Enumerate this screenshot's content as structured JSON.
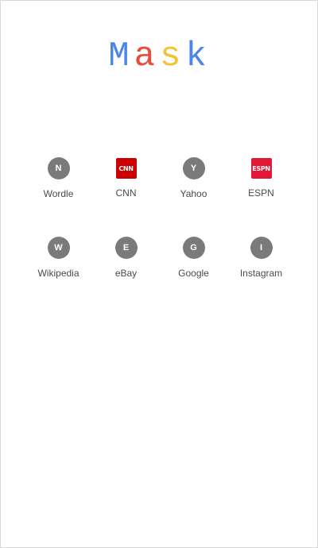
{
  "logo": {
    "letters": [
      "M",
      "a",
      "s",
      "k"
    ],
    "colors": [
      "#4a86e8",
      "#e84c3d",
      "#f2c230",
      "#4a86e8"
    ]
  },
  "shortcuts": [
    {
      "label": "Wordle",
      "initial": "N",
      "icon": "letter-icon"
    },
    {
      "label": "CNN",
      "initial": "CNN",
      "icon": "cnn-logo-icon",
      "color": "#cc0000"
    },
    {
      "label": "Yahoo",
      "initial": "Y",
      "icon": "letter-icon"
    },
    {
      "label": "ESPN",
      "initial": "ESPN",
      "icon": "espn-logo-icon",
      "color": "#e31837"
    },
    {
      "label": "Wikipedia",
      "initial": "W",
      "icon": "letter-icon"
    },
    {
      "label": "eBay",
      "initial": "E",
      "icon": "letter-icon"
    },
    {
      "label": "Google",
      "initial": "G",
      "icon": "letter-icon"
    },
    {
      "label": "Instagram",
      "initial": "I",
      "icon": "letter-icon"
    }
  ],
  "colors": {
    "default_icon": "#7a7a7a",
    "background": "#ffffff"
  }
}
